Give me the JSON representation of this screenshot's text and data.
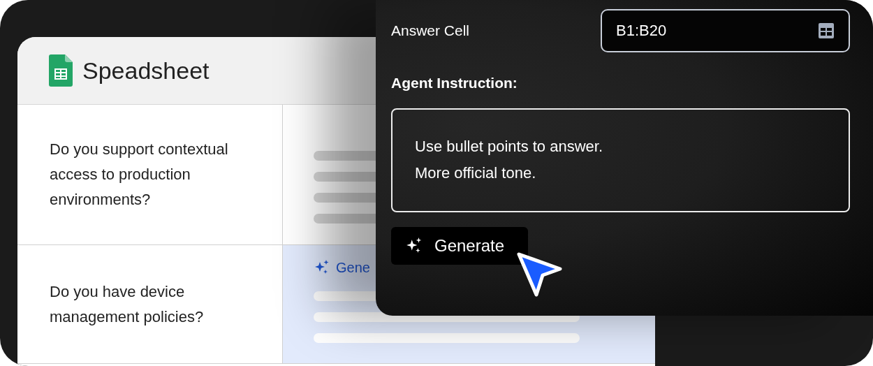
{
  "spreadsheet": {
    "title": "Speadsheet",
    "rows": [
      {
        "question": "Do you support contextual access to production environments?",
        "selected": false,
        "kind": "placeholder"
      },
      {
        "question": "Do you have device management policies?",
        "selected": true,
        "kind": "generating",
        "answer_label": "Gene"
      }
    ]
  },
  "panel": {
    "answer_cell": {
      "label": "Answer Cell",
      "value": "B1:B20"
    },
    "instruction": {
      "label": "Agent Instruction:",
      "lines": [
        "Use bullet points to answer.",
        "More official tone."
      ]
    },
    "button": "Generate"
  }
}
